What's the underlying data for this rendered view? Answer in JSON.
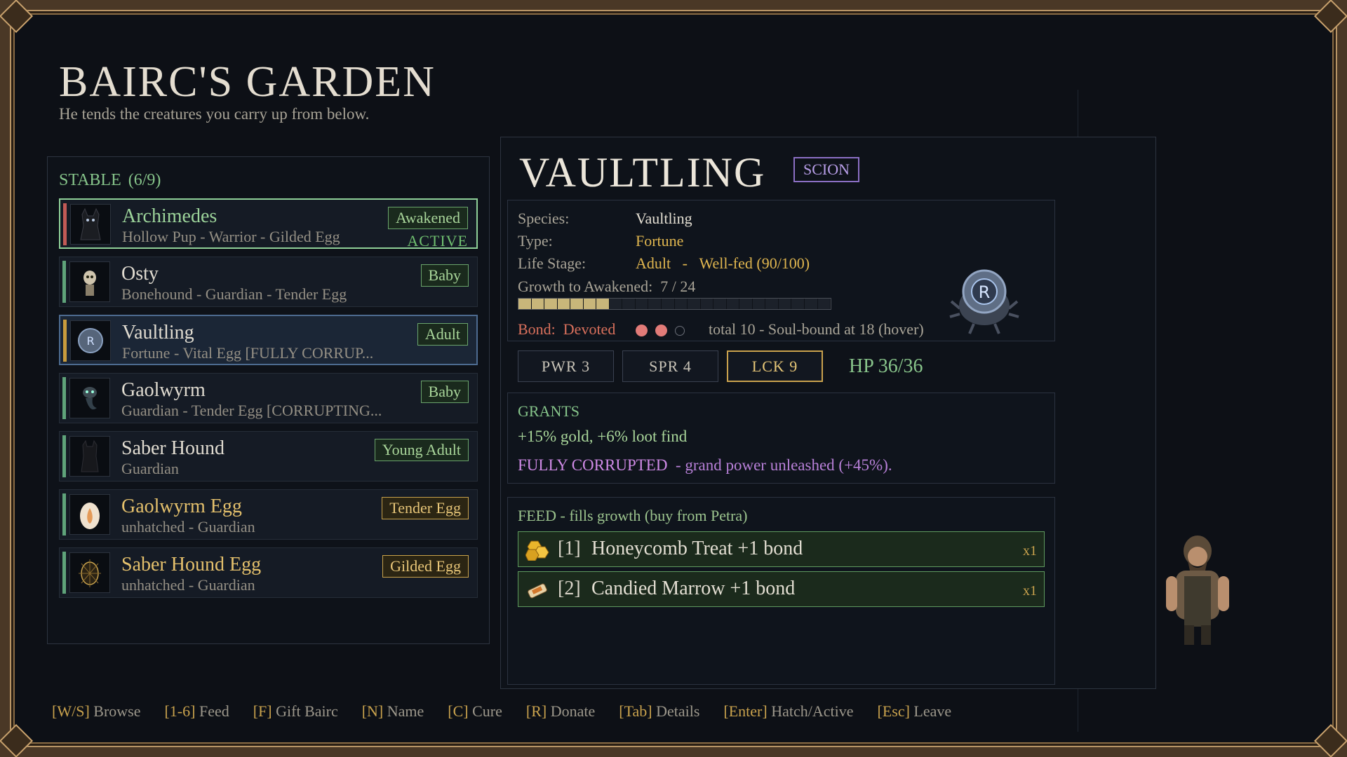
{
  "header": {
    "title": "BAIRC'S GARDEN",
    "subtitle": "He tends the creatures you carry up from below."
  },
  "stable": {
    "label": "STABLE",
    "count": "(6/9)",
    "rows": [
      {
        "name": "Archimedes",
        "sub": "Hollow Pup  -  Warrior  -  Gilded Egg",
        "badge": "Awakened",
        "status": "ACTIVE"
      },
      {
        "name": "Osty",
        "sub": "Bonehound  -  Guardian  -  Tender Egg",
        "badge": "Baby"
      },
      {
        "name": "Vaultling",
        "sub": "Fortune  -  Vital Egg  [FULLY CORRUP...",
        "badge": "Adult"
      },
      {
        "name": "Gaolwyrm",
        "sub": "Guardian  -  Tender Egg  [CORRUPTING...",
        "badge": "Baby"
      },
      {
        "name": "Saber Hound",
        "sub": "Guardian",
        "badge": "Young Adult"
      },
      {
        "name": "Gaolwyrm Egg",
        "sub": "unhatched  -  Guardian",
        "badge": "Tender Egg"
      },
      {
        "name": "Saber Hound Egg",
        "sub": "unhatched  -  Guardian",
        "badge": "Gilded Egg"
      }
    ]
  },
  "detail": {
    "name": "VAULTLING",
    "tag": "SCION",
    "species_label": "Species:",
    "species": "Vaultling",
    "type_label": "Type:",
    "type": "Fortune",
    "stage_label": "Life Stage:",
    "stage": "Adult",
    "stage_sep": "-",
    "fed": "Well-fed (90/100)",
    "growth_label": "Growth to Awakened:",
    "growth": "7 / 24",
    "growth_value": 7,
    "growth_max": 24,
    "bond_label": "Bond:",
    "bond": "Devoted",
    "bond_filled": 2,
    "bond_max": 3,
    "bond_total": "total 10  -  Soul-bound at 18  (hover)",
    "stats": {
      "pwr": "PWR  3",
      "spr": "SPR  4",
      "lck": "LCK  9"
    },
    "hp": "HP 36/36",
    "grants_title": "GRANTS",
    "grants_line": "+15% gold, +6% loot find",
    "corrupt_tag": "FULLY CORRUPTED",
    "corrupt_text": "-  grand power unleashed (+45%).",
    "feed_title": "FEED  -  fills growth  (buy from Petra)",
    "feed_items": [
      {
        "key": "[1]",
        "label": "Honeycomb Treat    +1 bond",
        "qty": "x1"
      },
      {
        "key": "[2]",
        "label": "Candied Marrow    +1 bond",
        "qty": "x1"
      }
    ]
  },
  "keys": [
    {
      "k": "[W/S]",
      "t": "Browse"
    },
    {
      "k": "[1-6]",
      "t": "Feed"
    },
    {
      "k": "[F]",
      "t": "Gift Bairc"
    },
    {
      "k": "[N]",
      "t": "Name"
    },
    {
      "k": "[C]",
      "t": "Cure"
    },
    {
      "k": "[R]",
      "t": "Donate"
    },
    {
      "k": "[Tab]",
      "t": "Details"
    },
    {
      "k": "[Enter]",
      "t": "Hatch/Active"
    },
    {
      "k": "[Esc]",
      "t": "Leave"
    }
  ]
}
